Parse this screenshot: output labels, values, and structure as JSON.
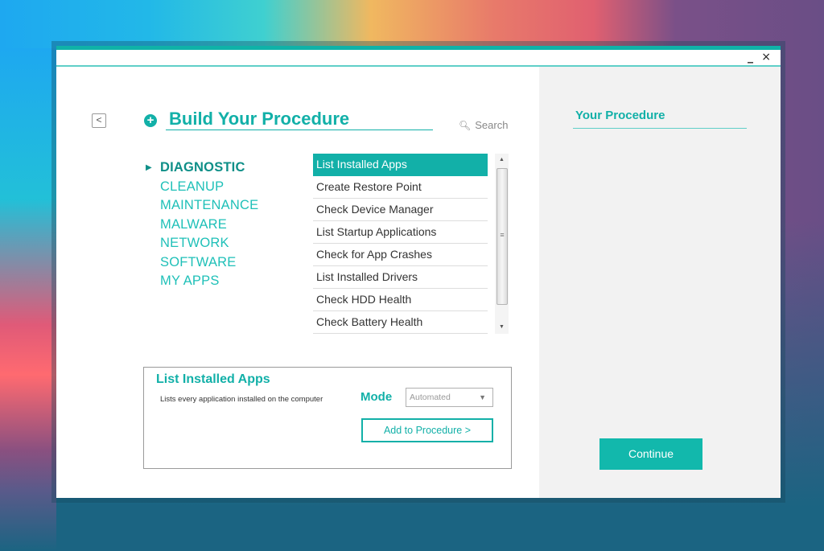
{
  "window": {
    "minimize_label": "_",
    "close_label": "×"
  },
  "header": {
    "back_label": "<",
    "plus_icon": "+",
    "title": "Build Your Procedure",
    "search_icon": "🔍︎",
    "search_label": "Search"
  },
  "categories": [
    {
      "label": "DIAGNOSTIC",
      "active": true
    },
    {
      "label": "CLEANUP",
      "active": false
    },
    {
      "label": "MAINTENANCE",
      "active": false
    },
    {
      "label": "MALWARE",
      "active": false
    },
    {
      "label": "NETWORK",
      "active": false
    },
    {
      "label": "SOFTWARE",
      "active": false
    },
    {
      "label": "MY APPS",
      "active": false
    }
  ],
  "active_arrow": "▶",
  "tasks": [
    {
      "label": "List Installed Apps",
      "selected": true
    },
    {
      "label": "Create Restore Point",
      "selected": false
    },
    {
      "label": "Check Device Manager",
      "selected": false
    },
    {
      "label": "List Startup Applications",
      "selected": false
    },
    {
      "label": "Check for App Crashes",
      "selected": false
    },
    {
      "label": "List Installed Drivers",
      "selected": false
    },
    {
      "label": "Check HDD Health",
      "selected": false
    },
    {
      "label": "Check Battery Health",
      "selected": false
    }
  ],
  "scrollbar": {
    "up": "▲",
    "down": "▼",
    "grip": "≡"
  },
  "detail": {
    "title": "List Installed Apps",
    "description": "Lists every application installed on the computer",
    "mode_label": "Mode",
    "mode_value": "Automated",
    "mode_caret": "▼",
    "add_button": "Add to Procedure >"
  },
  "procedure": {
    "title": "Your Procedure",
    "continue_button": "Continue"
  },
  "colors": {
    "accent": "#12b0a8",
    "accent_dark": "#0f8f88",
    "panel_bg": "#f2f2f2",
    "desktop_bg": "#1b6482"
  }
}
